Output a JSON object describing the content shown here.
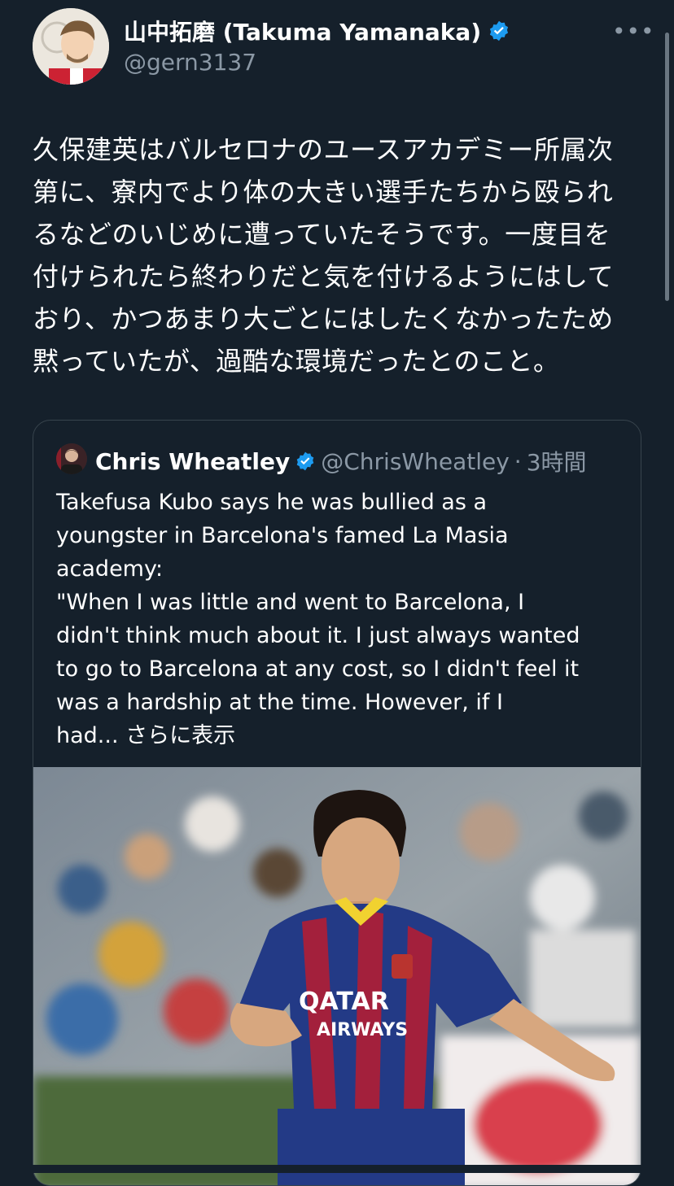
{
  "author": {
    "name": "山中拓磨 (Takuma Yamanaka)",
    "handle": "@gern3137",
    "more_label": "•••"
  },
  "tweet": {
    "lines": [
      "久保建英はバルセロナのユースアカデミー所属次",
      "第に、寮内でより体の大きい選手たちから殴られ",
      "るなどのいじめに遭っていたそうです。一度目を",
      "付けられたら終わりだと気を付けるようにはして",
      "おり、かつあまり大ごとにはしたくなかったため",
      "黙っていたが、過酷な環境だったとのこと。"
    ]
  },
  "quote": {
    "name": "Chris Wheatley",
    "handle": "@ChrisWheatley",
    "separator": "·",
    "time": "3時間",
    "lines": [
      "Takefusa Kubo says he was bullied as a",
      "youngster in Barcelona's famed La Masia",
      "academy:",
      "\"When I was little and went to Barcelona, I",
      "didn't think much about it. I just always wanted",
      "to go to Barcelona at any cost, so I didn't feel it",
      "was a hardship at the time. However, if I"
    ],
    "last_line_prefix": "had...",
    "show_more": "さらに表示",
    "photo_text": {
      "sponsor_top": "QATAR",
      "sponsor_bottom": "AIRWAYS"
    }
  },
  "colors": {
    "background": "#15202b",
    "text": "#ffffff",
    "secondary": "#8b98a5",
    "verified": "#1d9bf0",
    "border": "#38444d"
  }
}
